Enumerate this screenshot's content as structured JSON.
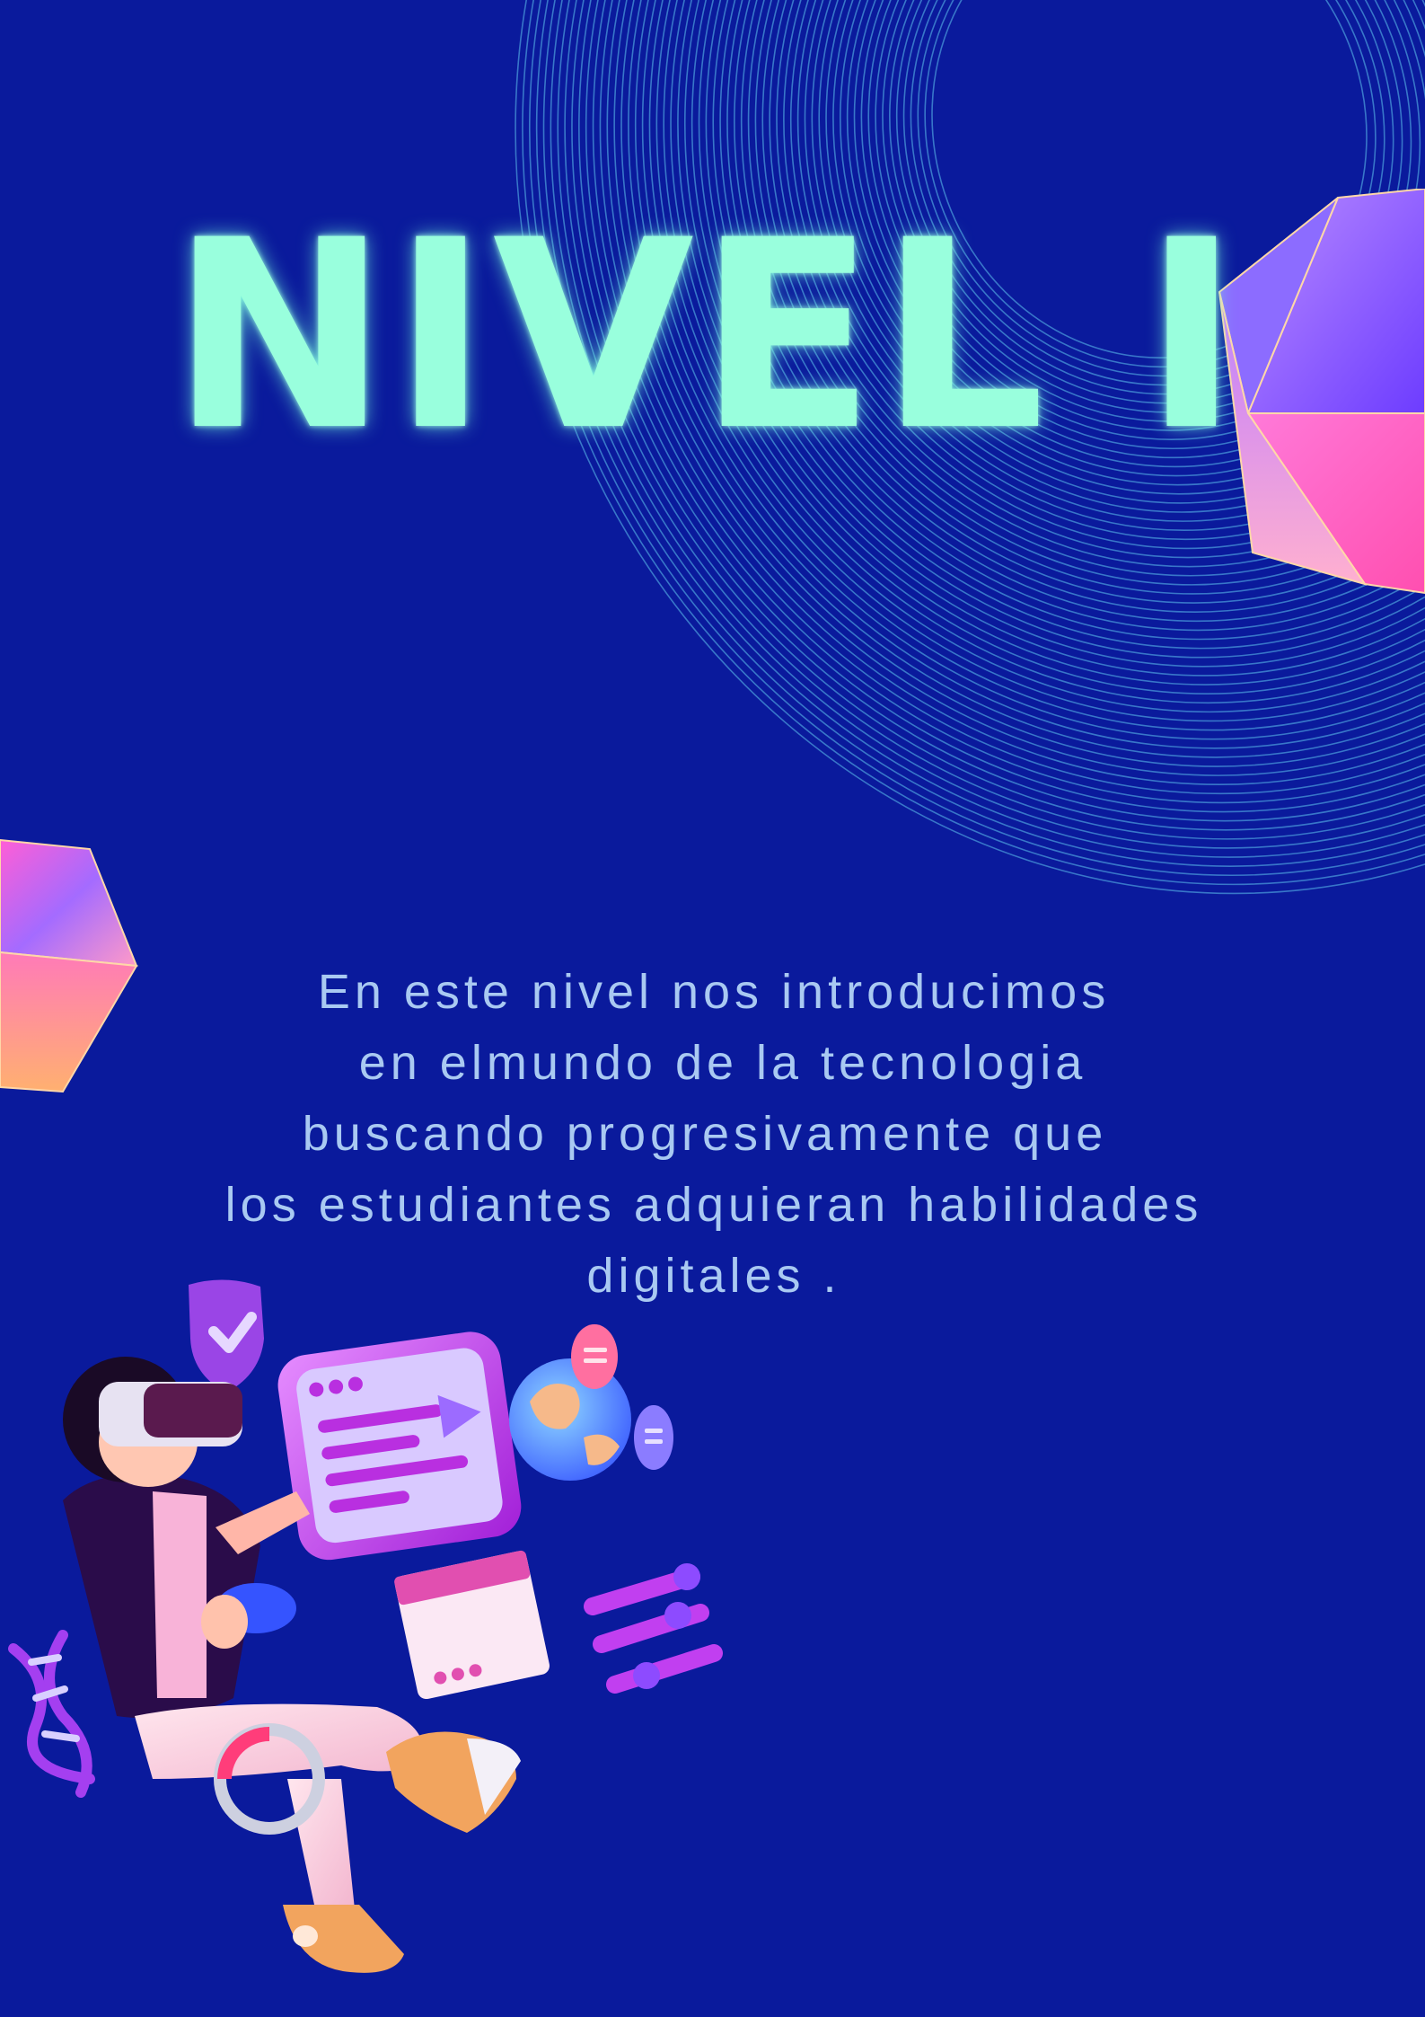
{
  "page": {
    "background": "#0a1a9c",
    "title": "NIVEL I",
    "title_color": "#99ffdd",
    "text_color": "#a9c9f2",
    "paragraph_lines": [
      "En este nivel nos introducimos",
      " en elmundo de la tecnologia",
      "buscando progresivamente que ",
      "los estudiantes adquieran habilidades",
      "digitales ."
    ]
  },
  "decorations": {
    "swirl": "concentric-line-swirl",
    "gem_right": "faceted-gem-icon",
    "gem_left": "faceted-gem-icon",
    "illustration": "vr-gamer-illustration"
  }
}
